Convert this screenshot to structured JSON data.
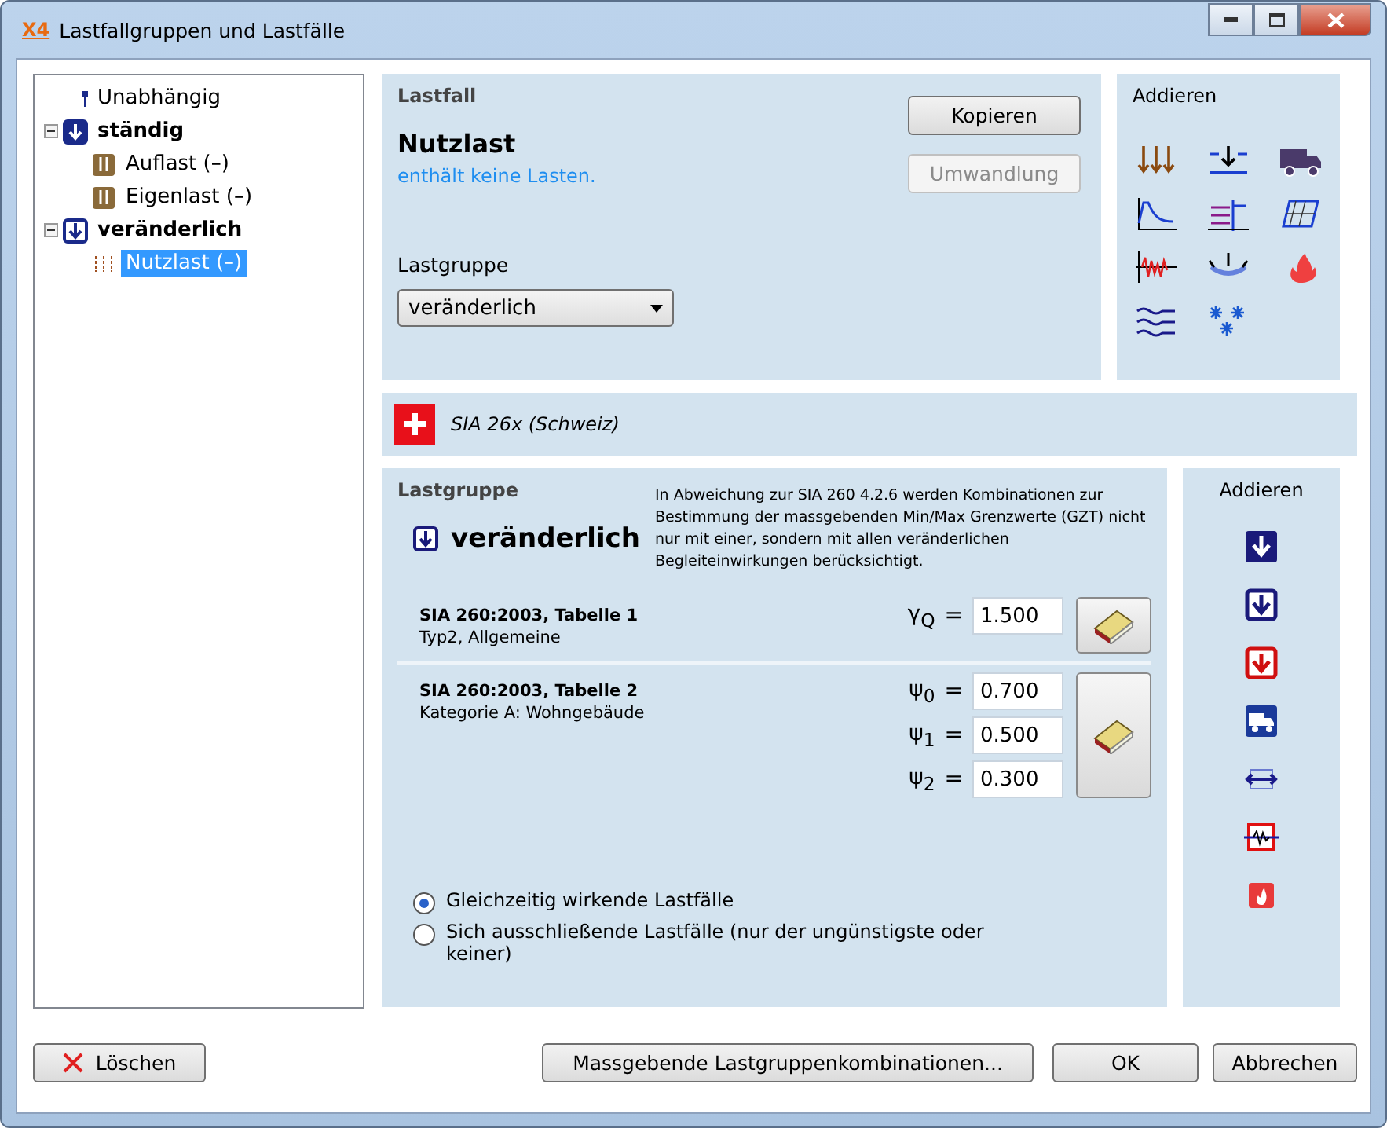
{
  "window": {
    "title": "Lastfallgruppen und Lastfälle",
    "logo": "X4"
  },
  "tree": [
    {
      "label": "Unabhängig",
      "kind": "independent",
      "selected": false
    },
    {
      "label": "ständig",
      "kind": "permanent-group",
      "selected": false,
      "expanded": true,
      "children": [
        {
          "label": "Auflast (–)",
          "kind": "permanent-case",
          "selected": false
        },
        {
          "label": "Eigenlast (–)",
          "kind": "permanent-case",
          "selected": false
        }
      ]
    },
    {
      "label": "veränderlich",
      "kind": "variable-group",
      "selected": false,
      "expanded": true,
      "children": [
        {
          "label": "Nutzlast (–)",
          "kind": "variable-case",
          "selected": true
        }
      ]
    }
  ],
  "lastfall": {
    "heading": "Lastfall",
    "name": "Nutzlast",
    "info": "enthält keine Lasten.",
    "copy_button": {
      "label": "Kopieren",
      "disabled": false
    },
    "convert_button": {
      "label": "Umwandlung",
      "disabled": true
    },
    "group_label": "Lastgruppe",
    "group_value": "veränderlich"
  },
  "add_loads": {
    "heading": "Addieren"
  },
  "norm": {
    "label": "SIA 26x (Schweiz)"
  },
  "lastgruppe": {
    "heading": "Lastgruppe",
    "name": "veränderlich",
    "note": "In Abweichung zur SIA 260 4.2.6 werden Kombinationen zur Bestimmung der massgebenden Min/Max Grenzwerte (GZT) nicht nur mit einer, sondern mit allen veränderlichen Begleiteinwirkungen berücksichtigt.",
    "tables": [
      {
        "title": "SIA 260:2003, Tabelle 1",
        "subtitle": "Typ2, Allgemeine",
        "factors": [
          {
            "symbol": "γ$_{Q}$",
            "equals": "=",
            "value": "1.500"
          }
        ]
      },
      {
        "title": "SIA 260:2003, Tabelle 2",
        "subtitle": "Kategorie A: Wohngebäude",
        "factors": [
          {
            "symbol": "ψ$_{0}$",
            "equals": "=",
            "value": "0.700"
          },
          {
            "symbol": "ψ$_{1}$",
            "equals": "=",
            "value": "0.500"
          },
          {
            "symbol": "ψ$_{2}$",
            "equals": "=",
            "value": "0.300"
          }
        ]
      }
    ],
    "options": [
      {
        "label": "Gleichzeitig wirkende Lastfälle",
        "selected": true
      },
      {
        "label": "Sich ausschließende Lastfälle (nur der ungünstigste oder keiner)",
        "selected": false
      }
    ]
  },
  "add_groups": {
    "heading": "Addieren"
  },
  "buttons": {
    "delete": "Löschen",
    "combinations": "Massgebende Lastgruppenkombinationen...",
    "ok": "OK",
    "cancel": "Abbrechen"
  }
}
